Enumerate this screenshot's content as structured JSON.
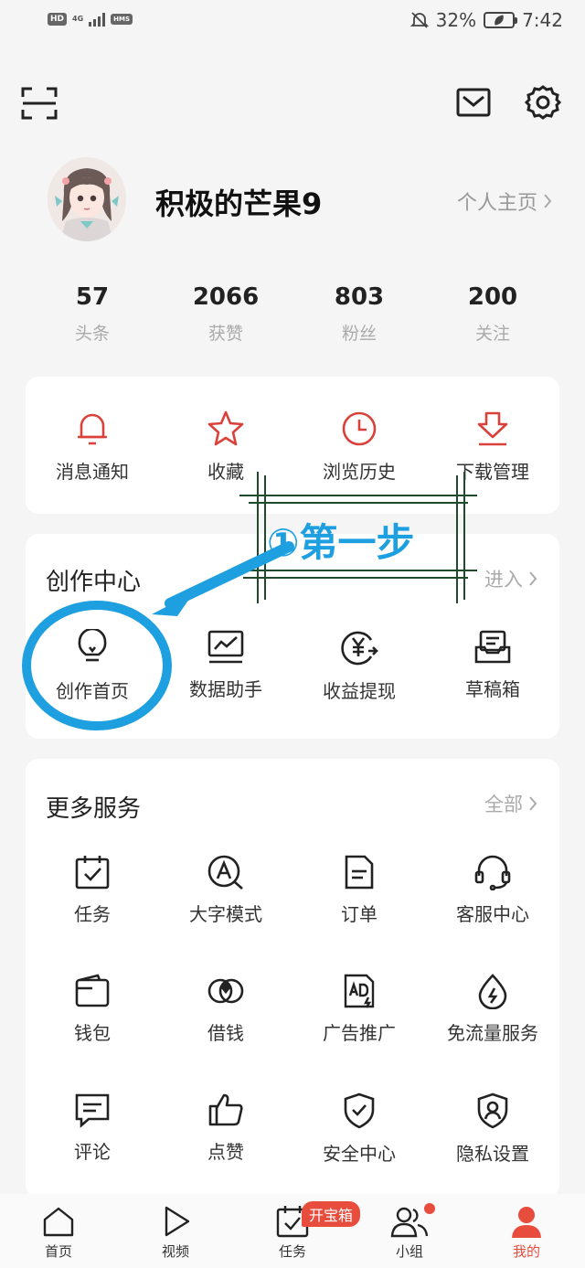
{
  "status_bar": {
    "hd": "HD",
    "net": "4G",
    "hms": "HMS",
    "battery": "32%",
    "time": "7:42"
  },
  "profile": {
    "name": "积极的芒果9",
    "homepage_link": "个人主页"
  },
  "stats": [
    {
      "value": "57",
      "label": "头条"
    },
    {
      "value": "2066",
      "label": "获赞"
    },
    {
      "value": "803",
      "label": "粉丝"
    },
    {
      "value": "200",
      "label": "关注"
    }
  ],
  "quick_actions": [
    {
      "label": "消息通知",
      "icon": "bell-icon"
    },
    {
      "label": "收藏",
      "icon": "star-icon"
    },
    {
      "label": "浏览历史",
      "icon": "clock-icon"
    },
    {
      "label": "下载管理",
      "icon": "download-icon"
    }
  ],
  "creation_center": {
    "title": "创作中心",
    "more": "进入",
    "items": [
      {
        "label": "创作首页",
        "icon": "lightbulb-icon"
      },
      {
        "label": "数据助手",
        "icon": "chart-icon"
      },
      {
        "label": "收益提现",
        "icon": "yuan-icon"
      },
      {
        "label": "草稿箱",
        "icon": "drafts-icon"
      }
    ]
  },
  "annotation": {
    "text": "①第一步"
  },
  "more_services": {
    "title": "更多服务",
    "more": "全部",
    "items": [
      {
        "label": "任务",
        "icon": "task-icon"
      },
      {
        "label": "大字模式",
        "icon": "large-font-icon"
      },
      {
        "label": "订单",
        "icon": "order-icon"
      },
      {
        "label": "客服中心",
        "icon": "headset-icon"
      },
      {
        "label": "钱包",
        "icon": "wallet-icon"
      },
      {
        "label": "借钱",
        "icon": "loan-icon"
      },
      {
        "label": "广告推广",
        "icon": "ad-icon"
      },
      {
        "label": "免流量服务",
        "icon": "data-free-icon"
      },
      {
        "label": "评论",
        "icon": "comment-icon"
      },
      {
        "label": "点赞",
        "icon": "thumbs-up-icon"
      },
      {
        "label": "安全中心",
        "icon": "shield-check-icon"
      },
      {
        "label": "隐私设置",
        "icon": "privacy-icon"
      }
    ]
  },
  "bottom_nav": [
    {
      "label": "首页",
      "icon": "home-icon"
    },
    {
      "label": "视频",
      "icon": "play-icon"
    },
    {
      "label": "任务",
      "icon": "task-nav-icon",
      "badge": "开宝箱"
    },
    {
      "label": "小组",
      "icon": "group-icon"
    },
    {
      "label": "我的",
      "icon": "profile-icon",
      "active": true
    }
  ],
  "colors": {
    "accent": "#e84c3d",
    "annotation_blue": "#1e9fe0",
    "annotation_frame": "#1f4a2c"
  }
}
